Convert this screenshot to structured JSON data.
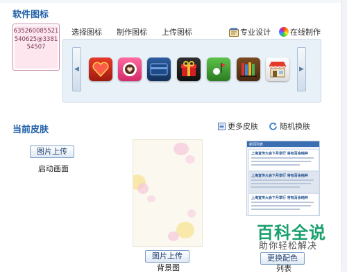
{
  "software_icons": {
    "title": "软件图标",
    "avatar_text": "635260085521540625@338154507",
    "tabs": [
      "选择图标",
      "制作图标",
      "上传图标"
    ],
    "tools": [
      {
        "label": "专业设计",
        "icon": "design-tool-icon"
      },
      {
        "label": "在线制作",
        "icon": "color-wheel-icon"
      }
    ],
    "icons": [
      {
        "name": "heart-app-icon"
      },
      {
        "name": "coffee-heart-app-icon"
      },
      {
        "name": "wallet-app-icon"
      },
      {
        "name": "gift-app-icon"
      },
      {
        "name": "golf-app-icon"
      },
      {
        "name": "books-app-icon"
      },
      {
        "name": "shop-app-icon"
      }
    ]
  },
  "current_skin": {
    "title": "当前皮肤",
    "more_skins": "更多皮肤",
    "random_skin": "随机换肤",
    "upload_button_1": "图片上传",
    "splash_label": "启动画面",
    "upload_button_2": "图片上传",
    "bg_label": "背景图",
    "change_color_button": "更换配色",
    "preview_label": "列表"
  },
  "preview": {
    "header": "新闻列表",
    "items": [
      "上海宣传大会下月举行 将有百余纯种",
      "上海宣传大会下月举行 将有百余纯种",
      "上海宣传大会下月举行 将有百余纯种"
    ]
  },
  "watermark": {
    "title": "百科全说",
    "subtitle": "助你轻松解决"
  },
  "colors": {
    "accent": "#1f5fa8",
    "watermark": "#1aa06d"
  }
}
